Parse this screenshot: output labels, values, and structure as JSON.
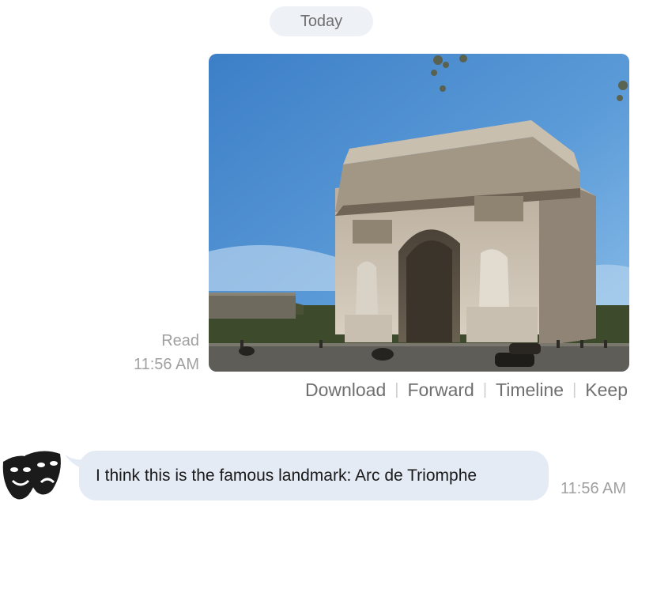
{
  "conversation": {
    "date_label": "Today",
    "image_message": {
      "image_subject": "Arc de Triomphe photo",
      "read_label": "Read",
      "time": "11:56 AM",
      "actions": [
        "Download",
        "Forward",
        "Timeline",
        "Keep"
      ]
    },
    "reply_message": {
      "avatar_icon": "theater-masks-icon",
      "text": "I think this is the famous landmark: Arc de Triomphe",
      "time": "11:56 AM",
      "bubble_color": "#e4ebf4"
    }
  }
}
